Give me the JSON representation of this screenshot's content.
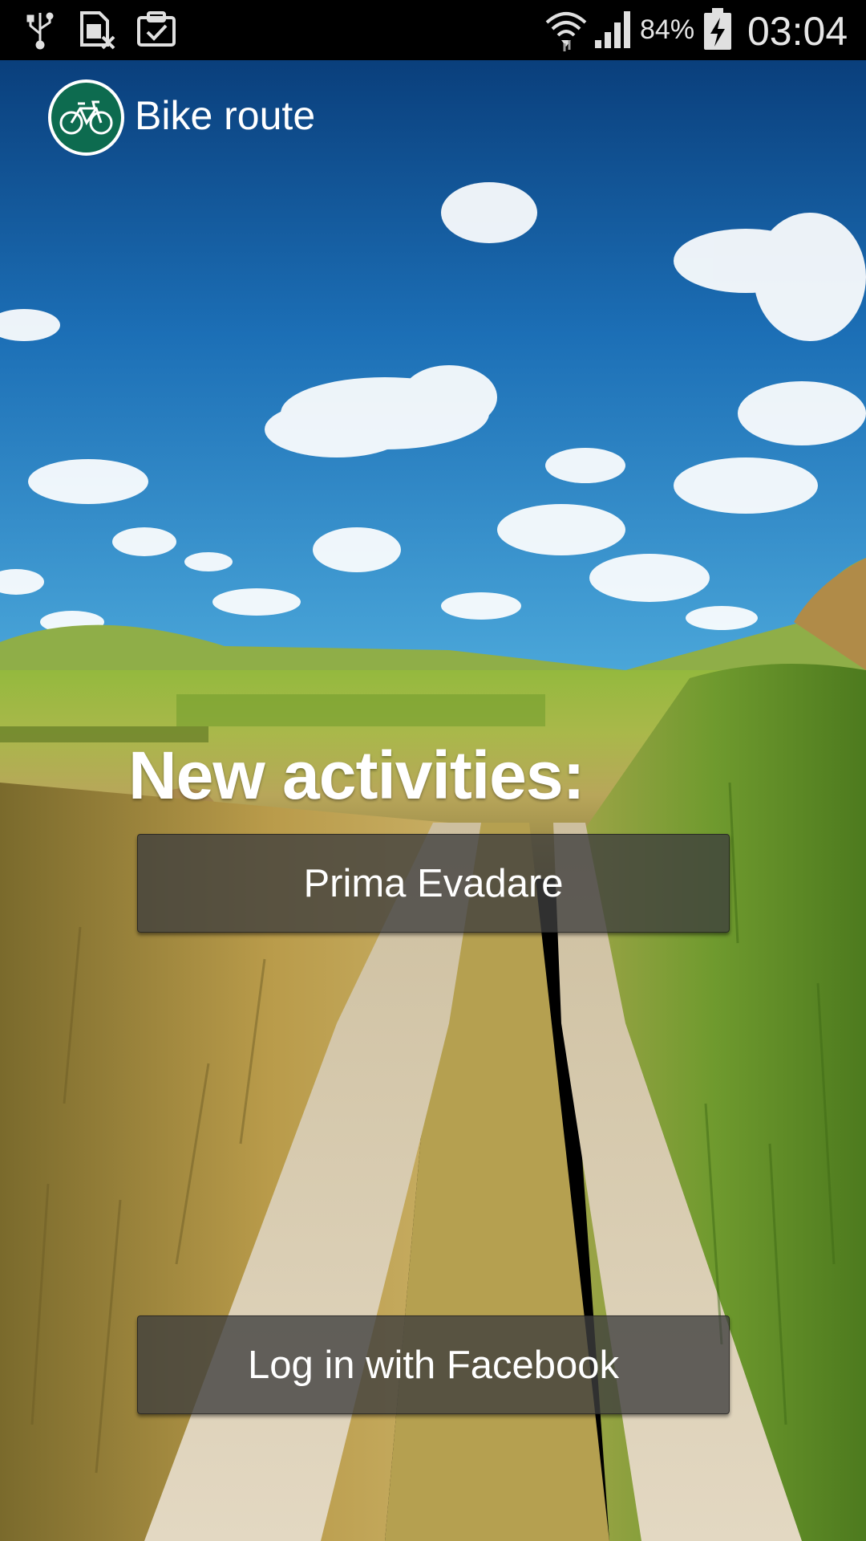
{
  "status_bar": {
    "battery_percent_text": "84%",
    "time": "03:04",
    "icons": [
      "usb-icon",
      "sim-card-error-icon",
      "clipboard-check-icon",
      "wifi-icon",
      "signal-icon",
      "battery-charging-icon"
    ]
  },
  "action_bar": {
    "title": "Bike route",
    "logo_icon": "bicycle-icon",
    "logo_color": "#0d6b4f"
  },
  "content": {
    "heading": "New activities:",
    "activities": [
      {
        "label": "Prima Evadare"
      }
    ],
    "login_button_label": "Log in with Facebook"
  },
  "colors": {
    "sky_top": "#0b4f8f",
    "sky_bottom": "#3a97d4",
    "grass": "#8db53c",
    "path": "#d8c8a8",
    "button_bg": "#3e3e3e"
  }
}
